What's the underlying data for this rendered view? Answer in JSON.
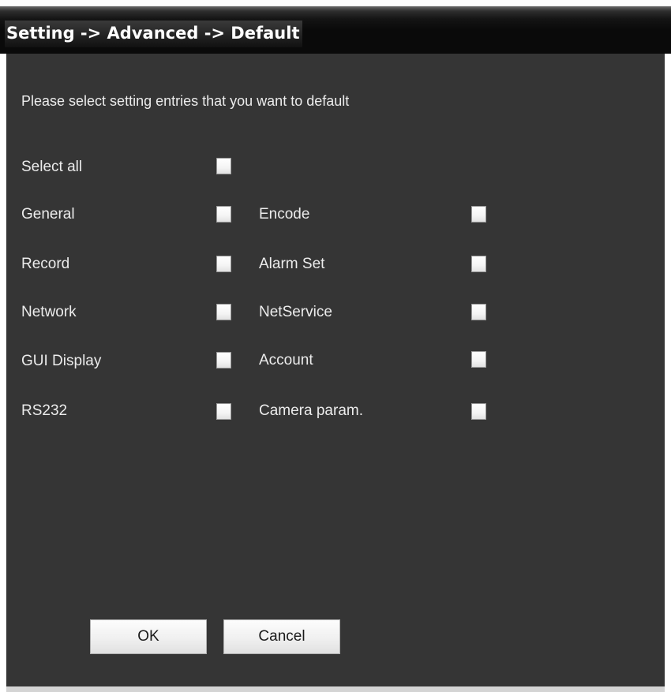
{
  "window": {
    "title": "Setting -> Advanced -> Default"
  },
  "panel": {
    "instruction": "Please select setting entries that you want to default",
    "select_all": {
      "label": "Select all",
      "checked": false
    },
    "left_entries": [
      {
        "label": "General",
        "checked": false
      },
      {
        "label": "Record",
        "checked": false
      },
      {
        "label": "Network",
        "checked": false
      },
      {
        "label": "GUI Display",
        "checked": false
      },
      {
        "label": "RS232",
        "checked": false
      }
    ],
    "right_entries": [
      {
        "label": "Encode",
        "checked": false
      },
      {
        "label": "Alarm Set",
        "checked": false
      },
      {
        "label": "NetService",
        "checked": false
      },
      {
        "label": "Account",
        "checked": false
      },
      {
        "label": "Camera param.",
        "checked": false
      }
    ]
  },
  "buttons": {
    "ok_label": "OK",
    "cancel_label": "Cancel"
  },
  "colors": {
    "panel_background": "#353535",
    "title_bar": "#0a0a0a",
    "text": "#ececec"
  }
}
